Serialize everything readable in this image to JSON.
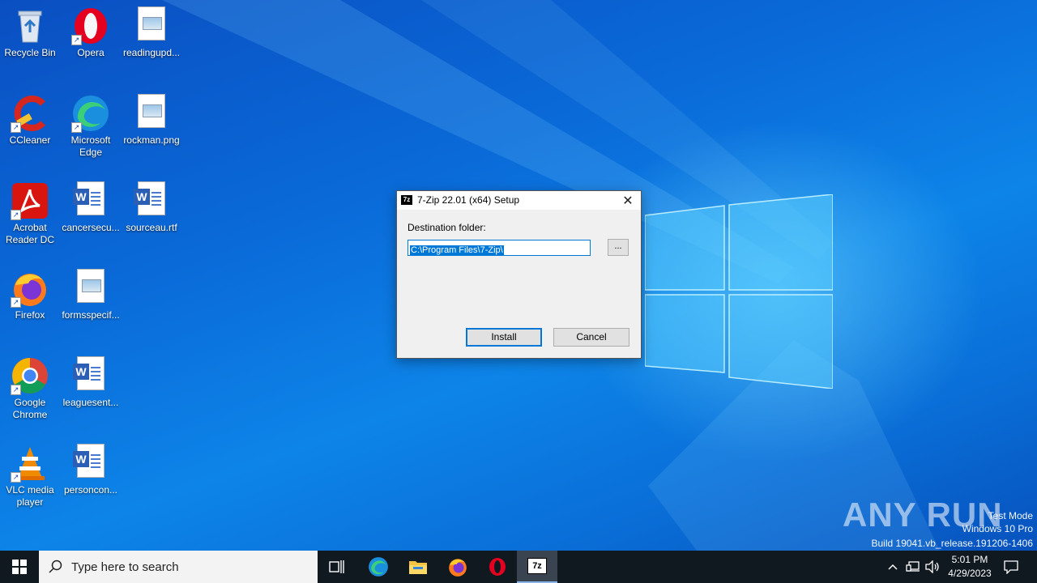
{
  "desktop": {
    "icons": [
      {
        "label": "Recycle Bin",
        "icon": "recycle-bin-icon"
      },
      {
        "label": "Opera",
        "icon": "opera-icon"
      },
      {
        "label": "readingupd...",
        "icon": "image-file-icon"
      },
      {
        "label": "CCleaner",
        "icon": "ccleaner-icon"
      },
      {
        "label": "Microsoft Edge",
        "icon": "edge-icon"
      },
      {
        "label": "rockman.png",
        "icon": "image-file-icon"
      },
      {
        "label": "Acrobat Reader DC",
        "icon": "acrobat-icon"
      },
      {
        "label": "cancersecu...",
        "icon": "word-doc-icon"
      },
      {
        "label": "sourceau.rtf",
        "icon": "word-doc-icon"
      },
      {
        "label": "Firefox",
        "icon": "firefox-icon"
      },
      {
        "label": "formsspecif...",
        "icon": "image-file-icon"
      },
      {
        "label": "Google Chrome",
        "icon": "chrome-icon"
      },
      {
        "label": "leaguesent...",
        "icon": "word-doc-icon"
      },
      {
        "label": "VLC media player",
        "icon": "vlc-icon"
      },
      {
        "label": "personcon...",
        "icon": "word-doc-icon"
      }
    ]
  },
  "dialog": {
    "title": "7-Zip 22.01 (x64) Setup",
    "icon_text": "7z",
    "destination_label": "Destination folder:",
    "path_value": "C:\\Program Files\\7-Zip\\",
    "browse_label": "...",
    "install_label": "Install",
    "cancel_label": "Cancel",
    "close_glyph": "✕"
  },
  "watermark": {
    "logo": "ANY RUN",
    "line1": "Test Mode",
    "line2": "Windows 10 Pro",
    "line3": "Build 19041.vb_release.191206-1406"
  },
  "taskbar": {
    "search_placeholder": "Type here to search",
    "apps": [
      "task-view-icon",
      "edge-icon",
      "file-explorer-icon",
      "firefox-icon",
      "opera-icon",
      "7zip-icon"
    ],
    "active_app_text": "7z",
    "clock_time": "5:01 PM",
    "clock_date": "4/29/2023"
  },
  "colors": {
    "accent": "#0078d7",
    "desktop": "#0a6ad8",
    "taskbar": "#101820"
  }
}
